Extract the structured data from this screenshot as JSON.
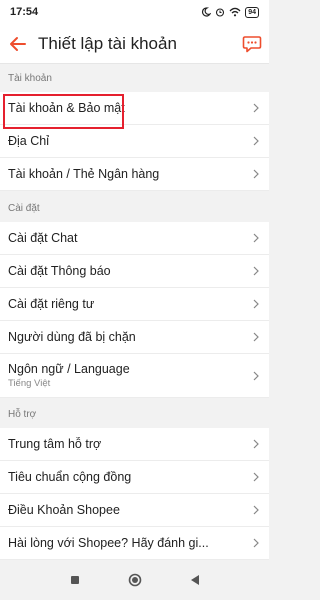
{
  "status_bar": {
    "time": "17:54",
    "battery": "94"
  },
  "header": {
    "title": "Thiết lập tài khoản"
  },
  "sections": {
    "account": {
      "title": "Tài khoản",
      "items": [
        "Tài khoản & Bảo mật",
        "Địa Chỉ",
        "Tài khoản / Thẻ Ngân hàng"
      ]
    },
    "settings": {
      "title": "Cài đặt",
      "items": [
        "Cài đặt Chat",
        "Cài đặt Thông báo",
        "Cài đặt riêng tư",
        "Người dùng đã bị chặn"
      ],
      "language": {
        "label": "Ngôn ngữ / Language",
        "value": "Tiếng Việt"
      }
    },
    "support": {
      "title": "Hỗ trợ",
      "items": [
        "Trung tâm hỗ trợ",
        "Tiêu chuẩn cộng đồng",
        "Điều Khoản Shopee",
        "Hài lòng với Shopee? Hãy đánh gi..."
      ]
    }
  },
  "colors": {
    "accent": "#ee4d2d",
    "highlight": "#e5202e"
  },
  "icons": {
    "back": "back-arrow-icon",
    "chat": "chat-icon",
    "chevron": "chevron-right-icon"
  }
}
